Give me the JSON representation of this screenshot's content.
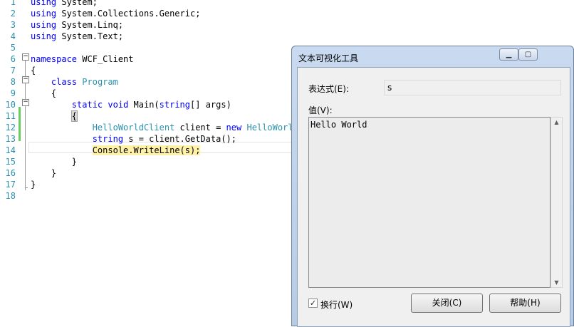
{
  "editor": {
    "lines": [
      {
        "n": "1",
        "segments": [
          {
            "t": "using",
            "c": "kw"
          },
          {
            "t": " System;"
          }
        ]
      },
      {
        "n": "2",
        "segments": [
          {
            "t": "using",
            "c": "kw"
          },
          {
            "t": " System.Collections.Generic;"
          }
        ]
      },
      {
        "n": "3",
        "segments": [
          {
            "t": "using",
            "c": "kw"
          },
          {
            "t": " System.Linq;"
          }
        ]
      },
      {
        "n": "4",
        "segments": [
          {
            "t": "using",
            "c": "kw"
          },
          {
            "t": " System.Text;"
          }
        ]
      },
      {
        "n": "5",
        "segments": []
      },
      {
        "n": "6",
        "segments": [
          {
            "t": "namespace",
            "c": "kw"
          },
          {
            "t": " WCF_Client"
          }
        ]
      },
      {
        "n": "7",
        "segments": [
          {
            "t": "{"
          }
        ]
      },
      {
        "n": "8",
        "segments": [
          {
            "t": "    "
          },
          {
            "t": "class",
            "c": "kw"
          },
          {
            "t": " "
          },
          {
            "t": "Program",
            "c": "ty"
          }
        ]
      },
      {
        "n": "9",
        "segments": [
          {
            "t": "    {"
          }
        ]
      },
      {
        "n": "10",
        "segments": [
          {
            "t": "        "
          },
          {
            "t": "static",
            "c": "kw"
          },
          {
            "t": " "
          },
          {
            "t": "void",
            "c": "kw"
          },
          {
            "t": " Main("
          },
          {
            "t": "string",
            "c": "kw"
          },
          {
            "t": "[] args)"
          }
        ]
      },
      {
        "n": "11",
        "segments": [
          {
            "t": "        "
          },
          {
            "t": "{",
            "c": "hl-brace"
          }
        ]
      },
      {
        "n": "12",
        "segments": [
          {
            "t": "            "
          },
          {
            "t": "HelloWorldClient",
            "c": "ty"
          },
          {
            "t": " client = "
          },
          {
            "t": "new",
            "c": "kw"
          },
          {
            "t": " "
          },
          {
            "t": "HelloWorldC",
            "c": "ty"
          }
        ]
      },
      {
        "n": "13",
        "segments": [
          {
            "t": "            "
          },
          {
            "t": "string",
            "c": "kw"
          },
          {
            "t": " s = client.GetData();"
          }
        ]
      },
      {
        "n": "14",
        "segments": [
          {
            "t": "            "
          },
          {
            "t": "Console",
            "c": "hl-yellow"
          },
          {
            "t": ".",
            "c": "hl-yellow"
          },
          {
            "t": "WriteLine",
            "c": "hl-yellow"
          },
          {
            "t": "(s);",
            "c": "hl-yellow"
          }
        ]
      },
      {
        "n": "15",
        "segments": [
          {
            "t": "        }"
          }
        ]
      },
      {
        "n": "16",
        "segments": [
          {
            "t": "    }"
          }
        ]
      },
      {
        "n": "17",
        "segments": [
          {
            "t": "}"
          }
        ]
      },
      {
        "n": "18",
        "segments": []
      }
    ]
  },
  "dialog": {
    "title": "文本可视化工具",
    "expression_label": "表达式(E):",
    "expression_value": "s",
    "value_label": "值(V):",
    "value_text": "Hello World",
    "wrap_label": "换行(W)",
    "wrap_checked": true,
    "close_button": "关闭(C)",
    "help_button": "帮助(H)",
    "minimize_icon": "minimize-icon",
    "maximize_icon": "maximize-icon"
  },
  "colors": {
    "keyword": "#0000ff",
    "type": "#2b91af",
    "line_number": "#2b91af",
    "current_statement": "#fff2a8",
    "change_bar": "#6ccb5e"
  }
}
